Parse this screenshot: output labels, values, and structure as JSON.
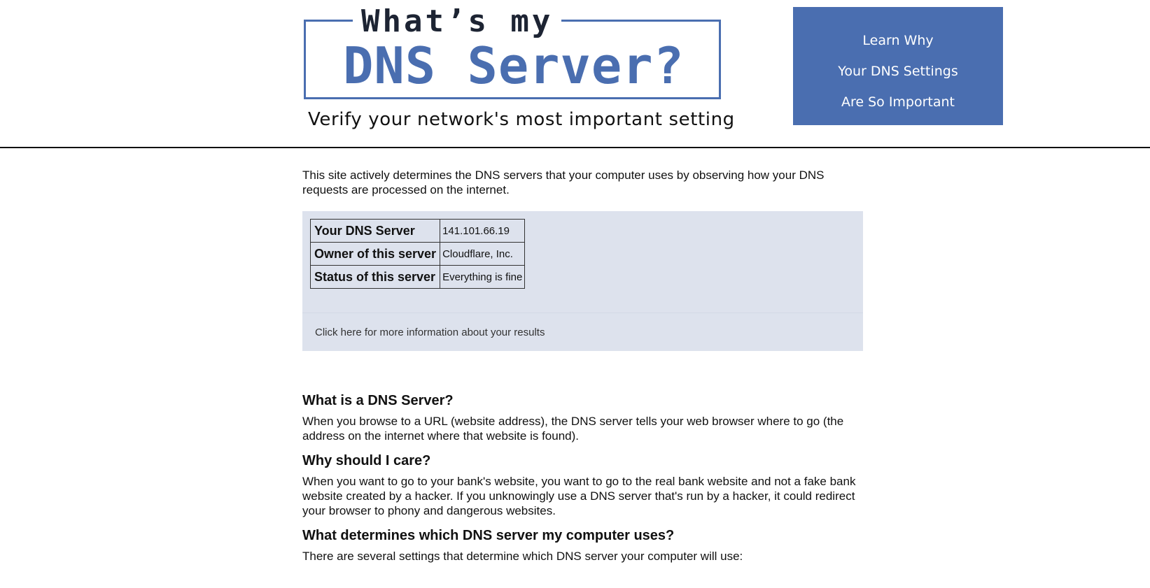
{
  "header": {
    "logo_line1": "What’s my",
    "logo_line2": "DNS Server?",
    "tagline": "Verify your network's most important setting",
    "learn_box": {
      "line1": "Learn Why",
      "line2": "Your DNS Settings",
      "line3": "Are So Important"
    }
  },
  "intro": "This site actively determines the DNS servers that your computer uses by observing how your DNS requests are processed on the internet.",
  "results": {
    "rows": [
      {
        "label": "Your DNS Server",
        "value": "141.101.66.19"
      },
      {
        "label": "Owner of this server",
        "value": "Cloudflare, Inc."
      },
      {
        "label": "Status of this server",
        "value": "Everything is fine"
      }
    ],
    "more_link": "Click here for more information about your results"
  },
  "faq": [
    {
      "heading": "What is a DNS Server?",
      "text": "When you browse to a URL (website address), the DNS server tells your web browser where to go (the address on the internet where that website is found)."
    },
    {
      "heading": "Why should I care?",
      "text": "When you want to go to your bank's website, you want to go to the real bank website and not a fake bank website created by a hacker. If you unknowingly use a DNS server that's run by a hacker, it could redirect your browser to phony and dangerous websites."
    },
    {
      "heading": "What determines which DNS server my computer uses?",
      "text": "There are several settings that determine which DNS server your computer will use:"
    }
  ],
  "colors": {
    "brand_blue": "#4a6eb0",
    "results_bg": "#dde2ed"
  }
}
